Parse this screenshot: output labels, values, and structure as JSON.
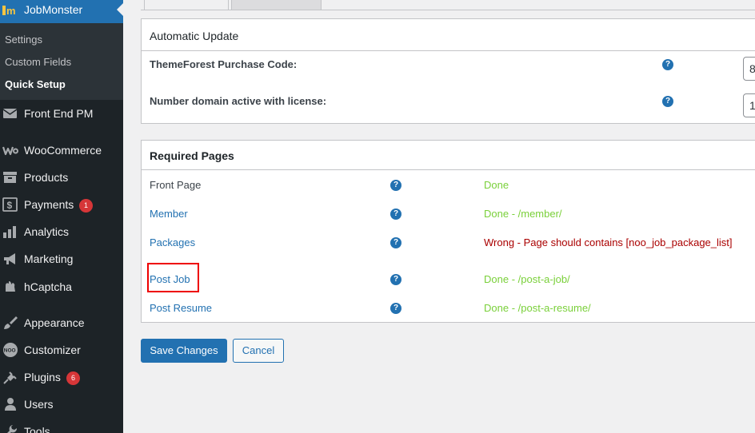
{
  "sidebar": {
    "app_title": "JobMonster",
    "submenu": [
      {
        "label": "Settings"
      },
      {
        "label": "Custom Fields"
      },
      {
        "label": "Quick Setup"
      }
    ],
    "items": [
      {
        "label": "Front End PM",
        "icon": "envelope-icon"
      },
      {
        "label": "WooCommerce",
        "icon": "woocommerce-icon"
      },
      {
        "label": "Products",
        "icon": "archive-icon"
      },
      {
        "label": "Payments",
        "icon": "dollar-icon",
        "badge": "1"
      },
      {
        "label": "Analytics",
        "icon": "bar-chart-icon"
      },
      {
        "label": "Marketing",
        "icon": "megaphone-icon"
      },
      {
        "label": "hCaptcha",
        "icon": "hcaptcha-icon"
      },
      {
        "label": "Appearance",
        "icon": "paintbrush-icon"
      },
      {
        "label": "Customizer",
        "icon": "noo-icon"
      },
      {
        "label": "Plugins",
        "icon": "plug-icon",
        "badge": "6"
      },
      {
        "label": "Users",
        "icon": "user-icon"
      },
      {
        "label": "Tools",
        "icon": "wrench-icon"
      }
    ]
  },
  "update_panel": {
    "title": "Automatic Update",
    "fields": [
      {
        "label": "ThemeForest Purchase Code:",
        "value": "8"
      },
      {
        "label": "Number domain active with license:",
        "value": "1"
      }
    ]
  },
  "pages_panel": {
    "title": "Required Pages",
    "rows": [
      {
        "name": "Front Page",
        "status": "Done"
      },
      {
        "name": "Member",
        "status": "Done - /member/"
      },
      {
        "name": "Packages",
        "status": "Wrong - Page should contains [noo_job_package_list]"
      },
      {
        "name": "Post Job",
        "status": "Done - /post-a-job/"
      },
      {
        "name": "Post Resume",
        "status": "Done - /post-a-resume/"
      }
    ]
  },
  "actions": {
    "save_label": "Save Changes",
    "cancel_label": "Cancel"
  },
  "colors": {
    "sidebar_bg": "#1d2327",
    "accent": "#2271b1",
    "done": "#7ad03a",
    "wrong": "#aa0000",
    "badge": "#d63638",
    "highlight": "#ee0000"
  }
}
